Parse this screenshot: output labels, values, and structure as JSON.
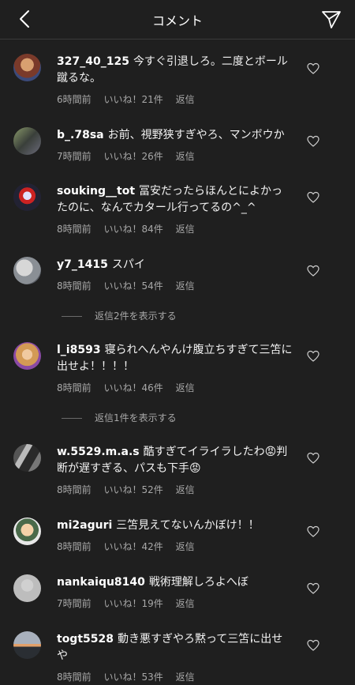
{
  "header": {
    "title": "コメント"
  },
  "comments": [
    {
      "user": "327_40_125",
      "text": "今すぐ引退しろ。二度とボール蹴るな。",
      "time": "6時間前",
      "likes": "いいね！21件",
      "reply": "返信"
    },
    {
      "user": "b_.78sa",
      "text": "お前、視野狭すぎやろ、マンボウか",
      "time": "7時間前",
      "likes": "いいね！26件",
      "reply": "返信"
    },
    {
      "user": "souking__tot",
      "text": "冨安だったらほんとによかったのに、なんでカタール行ってるの^_^",
      "time": "8時間前",
      "likes": "いいね！84件",
      "reply": "返信"
    },
    {
      "user": "y7_1415",
      "text": "スパイ",
      "time": "8時間前",
      "likes": "いいね！54件",
      "reply": "返信"
    },
    {
      "user": "l_i8593",
      "text": "寝られへんやんけ腹立ちすぎて三笘に出せよ！！！！",
      "time": "8時間前",
      "likes": "いいね！46件",
      "reply": "返信"
    },
    {
      "user": "w.5529.m.a.s",
      "text": "酷すぎてイライラしたわ😡判断が遅すぎる、パスも下手😡",
      "time": "8時間前",
      "likes": "いいね！52件",
      "reply": "返信"
    },
    {
      "user": "mi2aguri",
      "text": "三笘見えてないんかぼけ！！",
      "time": "8時間前",
      "likes": "いいね！42件",
      "reply": "返信"
    },
    {
      "user": "nankaiqu8140",
      "text": "戦術理解しろよへぼ",
      "time": "7時間前",
      "likes": "いいね！19件",
      "reply": "返信"
    },
    {
      "user": "togt5528",
      "text": "動き悪すぎやろ黙って三笘に出せや",
      "time": "8時間前",
      "likes": "いいね！53件",
      "reply": "返信"
    }
  ],
  "view_replies": [
    {
      "label": "返信2件を表示する"
    },
    {
      "label": "返信1件を表示する"
    }
  ],
  "icons": {
    "back": "chevron-left-icon",
    "send": "send-icon",
    "like": "heart-icon"
  }
}
